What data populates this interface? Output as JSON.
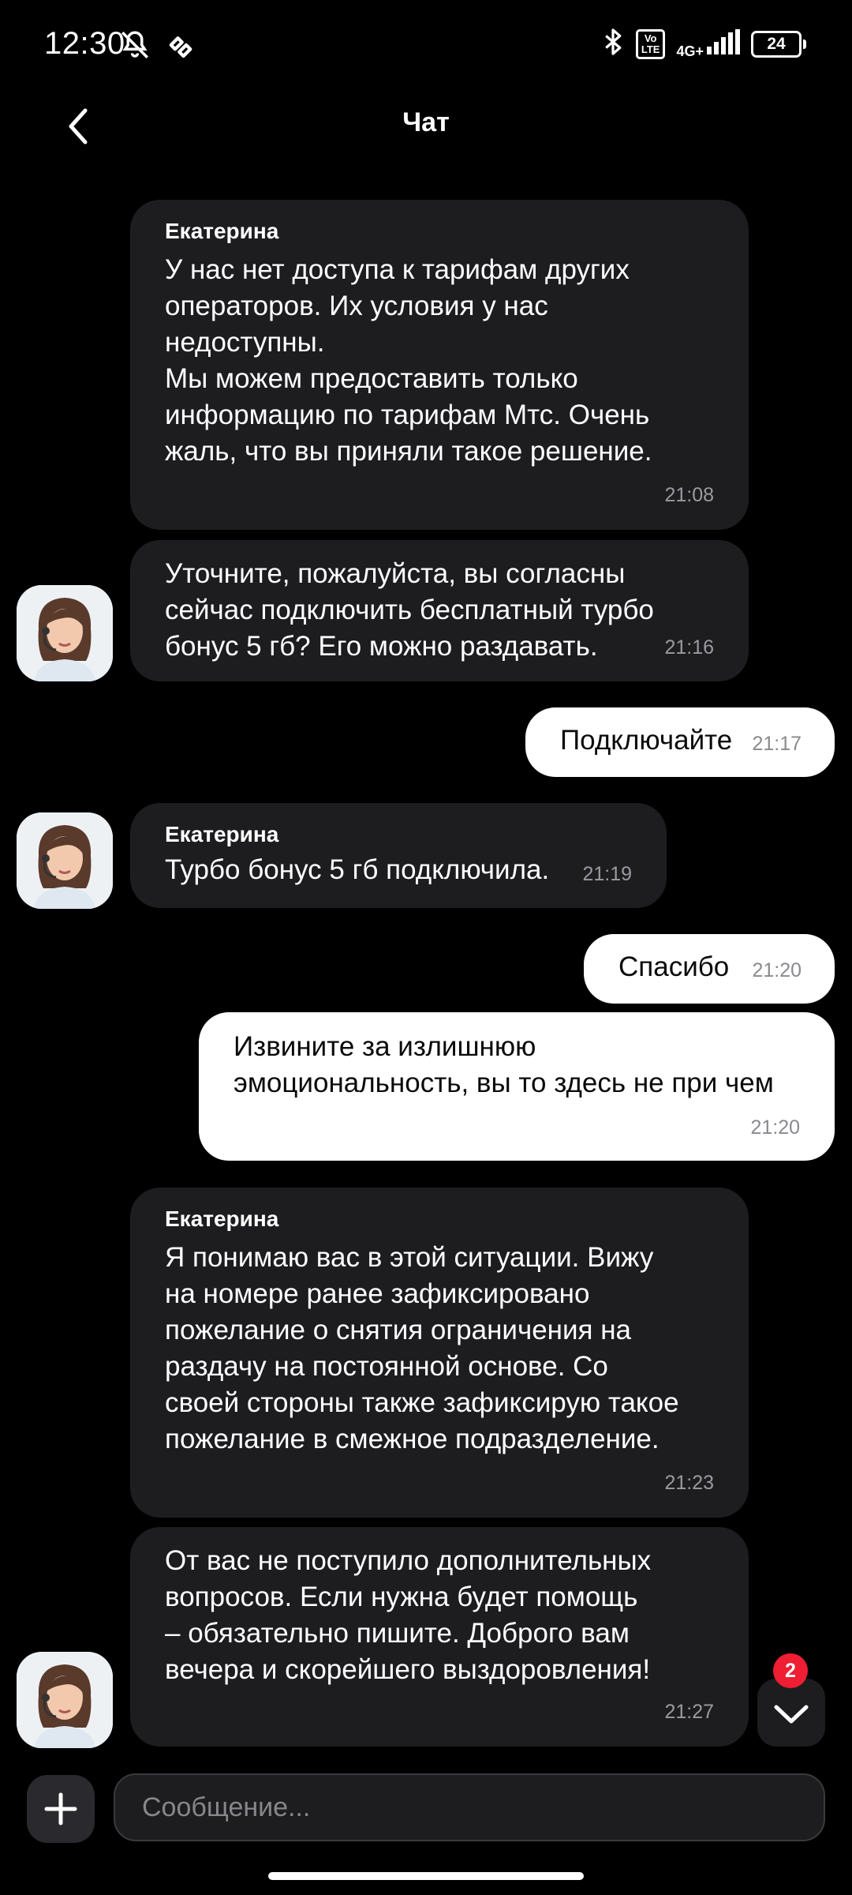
{
  "status_bar": {
    "time": "12:30",
    "volte": "Vo\nLTE",
    "network": "4G+",
    "battery": "24"
  },
  "header": {
    "title": "Чат"
  },
  "messages": [
    {
      "direction": "in",
      "sender": "Екатерина",
      "text": "У нас нет доступа к тарифам других\nоператоров. Их условия у нас\nнедоступны.\nМы можем предоставить только\nинформацию по тарифам Мтс. Очень\nжаль, что вы приняли такое решение.",
      "time": "21:08"
    },
    {
      "direction": "in",
      "sender": "",
      "text": "Уточните, пожалуйста, вы согласны\nсейчас подключить бесплатный турбо\nбонус 5 гб? Его можно раздавать.",
      "time": "21:16"
    },
    {
      "direction": "out",
      "text": "Подключайте",
      "time": "21:17"
    },
    {
      "direction": "in",
      "sender": "Екатерина",
      "text": "Турбо бонус 5 гб подключила.",
      "time": "21:19"
    },
    {
      "direction": "out",
      "text": "Спасибо",
      "time": "21:20"
    },
    {
      "direction": "out",
      "text": "Извините за излишнюю\nэмоциональность, вы то здесь не при чем",
      "time": "21:20"
    },
    {
      "direction": "in",
      "sender": "Екатерина",
      "text": "Я понимаю вас в этой ситуации. Вижу\nна номере ранее зафиксировано\nпожелание о снятия ограничения на\nраздачу на постоянной основе. Со\nсвоей стороны также зафиксирую такое\nпожелание в смежное подразделение.",
      "time": "21:23"
    },
    {
      "direction": "in",
      "sender": "",
      "text": "От вас не поступило дополнительных\nвопросов. Если нужна будет помощь\n– обязательно пишите. Доброго вам\nвечера и скорейшего выздоровления!",
      "time": "21:27"
    }
  ],
  "unread_badge": "2",
  "composer": {
    "placeholder": "Сообщение..."
  },
  "colors": {
    "incoming_bubble": "#1d1d20",
    "outgoing_bubble": "#ffffff",
    "badge": "#ef1e33"
  }
}
